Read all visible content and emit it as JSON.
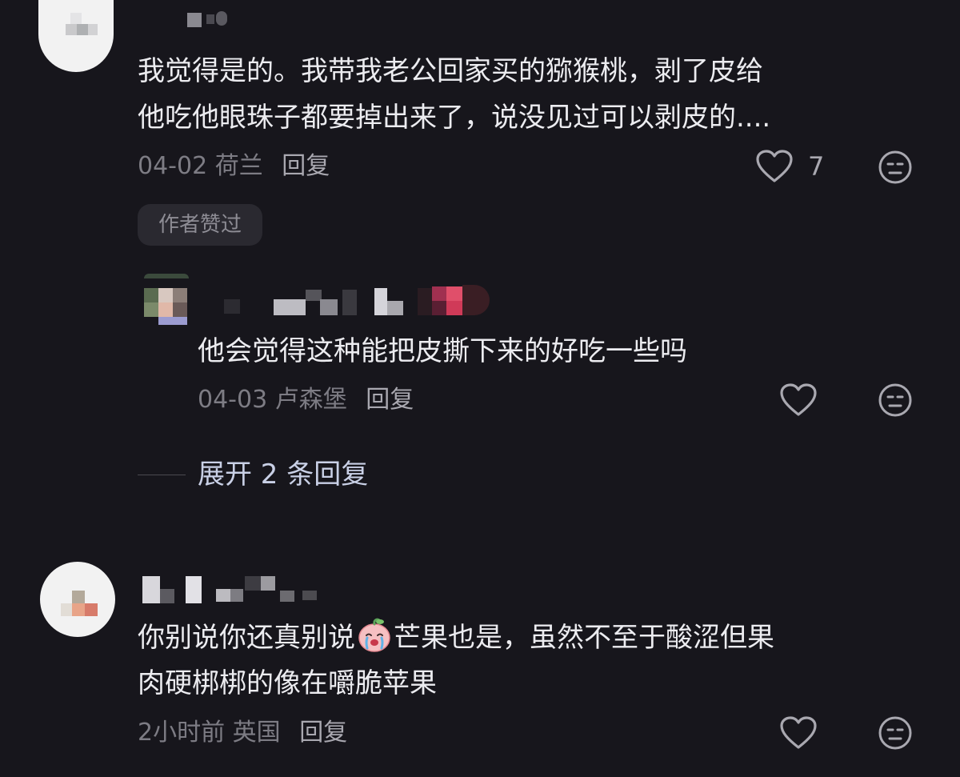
{
  "colors": {
    "background": "#17161c",
    "text_primary": "#ececf0",
    "text_secondary": "#7d7c84",
    "reply_label": "#a9a8b0",
    "expand_link": "#c9d0e6",
    "badge_bg": "#2a2930"
  },
  "comments": [
    {
      "text_line_1": "我觉得是的。我带我老公回家买的猕猴桃，剥了皮给",
      "text_line_2": "他吃他眼珠子都要掉出来了，说没见过可以剥皮的....",
      "date": "04-02",
      "location": "荷兰",
      "reply_label": "回复",
      "likes": "7",
      "like_icon": "heart-outline-icon",
      "dislike_icon": "meh-face-icon",
      "author_badge": "作者赞过"
    },
    {
      "text": "他会觉得这种能把皮撕下来的好吃一些吗",
      "date": "04-03",
      "location": "卢森堡",
      "reply_label": "回复",
      "like_icon": "heart-outline-icon",
      "dislike_icon": "meh-face-icon"
    },
    {
      "text_line_1_before_emoji": "你别说你还真别说",
      "emoji": "crying-peach-emoji",
      "text_line_1_after_emoji": "芒果也是，虽然不至于酸涩但果",
      "text_line_2": "肉硬梆梆的像在嚼脆苹果",
      "date": "2小时前",
      "location": "英国",
      "reply_label": "回复",
      "like_icon": "heart-outline-icon",
      "dislike_icon": "meh-face-icon"
    }
  ],
  "expand_replies": "展开 2 条回复"
}
